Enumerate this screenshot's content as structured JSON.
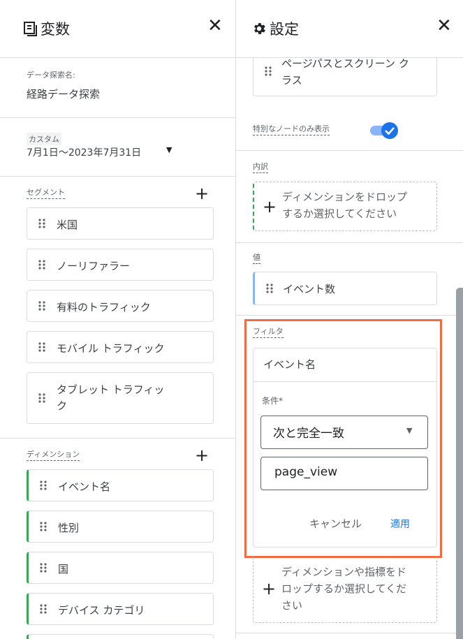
{
  "left_panel": {
    "title": "変数",
    "exploration_name_label": "データ探索名:",
    "exploration_name_value": "経路データ探索",
    "date_badge": "カスタム",
    "date_range": "7月1日～2023年7月31日",
    "segments_label": "セグメント",
    "segments": [
      "米国",
      "ノーリファラー",
      "有料のトラフィック",
      "モバイル トラフィック",
      "タブレット トラフィッ",
      "ク"
    ],
    "dimensions_label": "ディメンション",
    "dimensions": [
      "イベント名",
      "性別",
      "国",
      "デバイス カテゴリ"
    ]
  },
  "right_panel": {
    "title": "設定",
    "top_chip_line1": "ページパスとスクリーン ク",
    "top_chip_line2": "ラス",
    "special_nodes_label": "特別なノードのみ表示",
    "special_nodes_enabled": true,
    "breakdown_label": "内訳",
    "breakdown_drop_line1": "ディメンションをドロップ",
    "breakdown_drop_line2": "するか選択してください",
    "values_label": "値",
    "value_chip": "イベント数",
    "filter_label": "フィルタ",
    "filter_dimension": "イベント名",
    "condition_label": "条件*",
    "condition_value": "次と完全一致",
    "filter_value": "page_view",
    "cancel_label": "キャンセル",
    "apply_label": "適用",
    "bottom_drop_line1": "ディメンションや指標をド",
    "bottom_drop_line2": "ロップするか選択してくだ",
    "bottom_drop_line3": "さい"
  },
  "colors": {
    "accent_blue": "#1a73e8",
    "highlight_orange": "#f26b41",
    "dimension_green": "#34a853"
  }
}
